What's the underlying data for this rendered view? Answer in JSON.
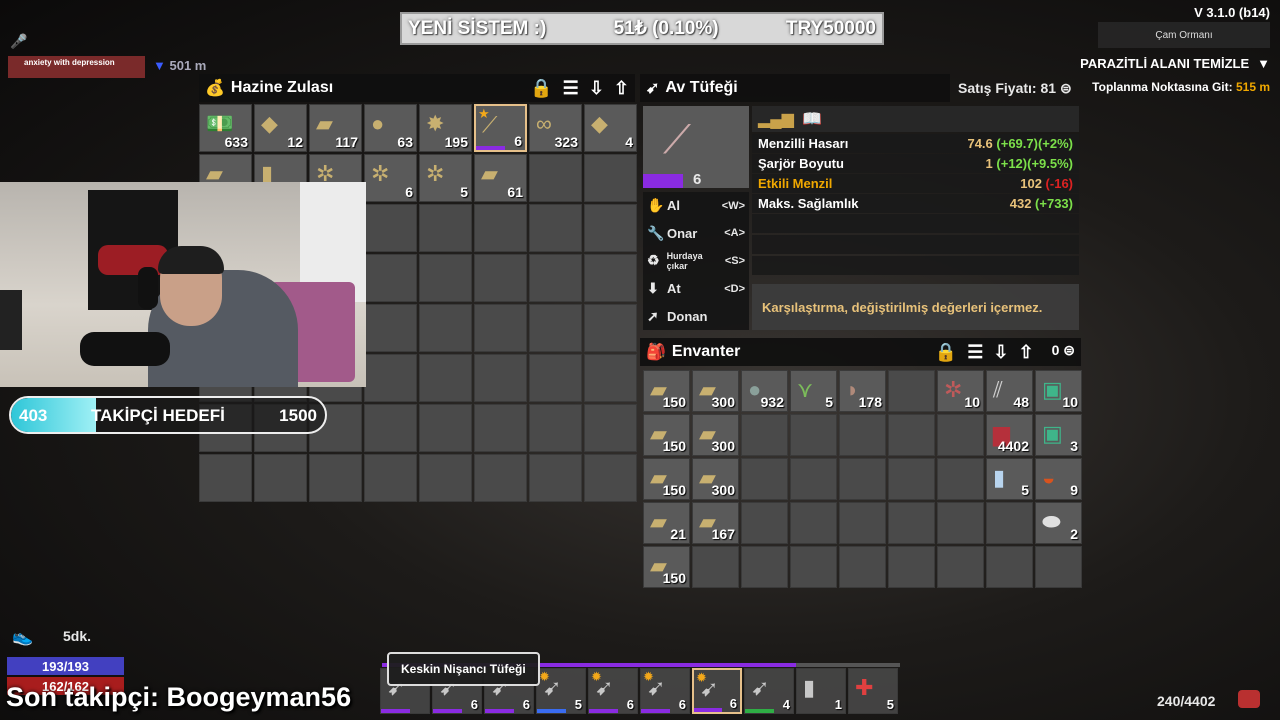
{
  "donation": {
    "label": "YENİ SİSTEM :)",
    "amount": "51₺ (0.10%)",
    "goal": "TRY50000"
  },
  "version": "V 3.1.0 (b14)",
  "biome": "Çam Ormanı",
  "quest": {
    "title": "PARAZİTLİ ALANI TEMİZLE",
    "objective": "Toplanma Noktasına Git: ",
    "distance": "515 m"
  },
  "party": {
    "member": "anxiety with depression",
    "distance": "501 m"
  },
  "chest": {
    "title": "Hazine Zulası",
    "items": [
      {
        "icon": "cash-icon",
        "glyph": "💵",
        "qty": "633"
      },
      {
        "icon": "silver-nuggets-icon",
        "glyph": "◆",
        "qty": "12"
      },
      {
        "icon": "ammo-round-icon",
        "glyph": "▰",
        "qty": "117"
      },
      {
        "icon": "grenade-icon",
        "glyph": "●",
        "qty": "63"
      },
      {
        "icon": "shotgun-shell-icon",
        "glyph": "✸",
        "qty": "195"
      },
      {
        "icon": "hunting-rifle-icon",
        "glyph": "⟋",
        "qty": "6",
        "star": true,
        "tier": true,
        "selected": true
      },
      {
        "icon": "chain-icon",
        "glyph": "∞",
        "qty": "323"
      },
      {
        "icon": "gold-nuggets-icon",
        "glyph": "◆",
        "qty": "4"
      },
      {
        "icon": "bullet-icon",
        "glyph": "▰",
        "qty": ""
      },
      {
        "icon": "casing-icon",
        "glyph": "▮",
        "qty": ""
      },
      {
        "icon": "parts-icon",
        "glyph": "✲",
        "qty": ""
      },
      {
        "icon": "rifle-parts-icon",
        "glyph": "✲",
        "qty": "6"
      },
      {
        "icon": "pistol-parts-icon",
        "glyph": "✲",
        "qty": "5"
      },
      {
        "icon": "bullet-tip-icon",
        "glyph": "▰",
        "qty": "61"
      }
    ],
    "total_slots": 64
  },
  "preview": {
    "title": "Av Tüfeği",
    "sell_label": "Satış Fiyatı: ",
    "sell_value": "81",
    "qty": "6",
    "actions": [
      {
        "icon": "hand-icon",
        "glyph": "✋",
        "label": "Al",
        "key": "<W>",
        "small": false
      },
      {
        "icon": "wrench-icon",
        "glyph": "🔧",
        "label": "Onar",
        "key": "<A>",
        "small": false
      },
      {
        "icon": "recycle-icon",
        "glyph": "♻",
        "label": "Hurdaya çıkar",
        "key": "<S>",
        "small": true
      },
      {
        "icon": "drop-arrow-icon",
        "glyph": "⬇",
        "label": "At",
        "key": "<D>",
        "small": false
      },
      {
        "icon": "equip-icon",
        "glyph": "➚",
        "label": "Donan",
        "key": "",
        "small": false
      }
    ],
    "stats": [
      {
        "label": "Menzilli Hasarı",
        "base": "74.6",
        "delta": "(+69.7)",
        "pct": "(+2%)",
        "label_color": "#ffffff",
        "delta_class": "pos"
      },
      {
        "label": "Şarjör Boyutu",
        "base": "1",
        "delta": "(+12)",
        "pct": "(+9.5%)",
        "label_color": "#ffffff",
        "delta_class": "pos"
      },
      {
        "label": "Etkili Menzil",
        "base": "102",
        "delta": "(-16)",
        "pct": "",
        "label_color": "#f0a800",
        "delta_class": "neg"
      },
      {
        "label": "Maks. Sağlamlık",
        "base": "432",
        "delta": "(+733)",
        "pct": "",
        "label_color": "#ffffff",
        "delta_class": "pos"
      }
    ],
    "compare_note": "Karşılaştırma, değiştirilmiş değerleri içermez."
  },
  "inventory": {
    "title": "Envanter",
    "coins": "0",
    "rows": [
      [
        {
          "icon": "rifle-ammo-icon",
          "qty": "150"
        },
        {
          "icon": "rifle-ammo-icon",
          "qty": "300"
        },
        {
          "icon": "stone-icon",
          "qty": "932"
        },
        {
          "icon": "plant-fiber-icon",
          "qty": "5"
        },
        {
          "icon": "meat-icon",
          "qty": "178"
        },
        {
          "icon": "",
          "qty": ""
        },
        {
          "icon": "gun-parts-icon",
          "qty": "10"
        },
        {
          "icon": "nails-icon",
          "qty": "48"
        },
        {
          "icon": "acid-jar-icon",
          "qty": "10"
        }
      ],
      [
        {
          "icon": "rifle-ammo-icon",
          "qty": "150"
        },
        {
          "icon": "rifle-ammo-icon",
          "qty": "300"
        },
        {
          "icon": "",
          "qty": ""
        },
        {
          "icon": "",
          "qty": ""
        },
        {
          "icon": "",
          "qty": ""
        },
        {
          "icon": "",
          "qty": ""
        },
        {
          "icon": "",
          "qty": ""
        },
        {
          "icon": "gas-can-icon",
          "qty": "4402"
        },
        {
          "icon": "acid-jar-icon",
          "qty": "3"
        }
      ],
      [
        {
          "icon": "rifle-ammo-icon",
          "qty": "150"
        },
        {
          "icon": "rifle-ammo-icon",
          "qty": "300"
        },
        {
          "icon": "",
          "qty": ""
        },
        {
          "icon": "",
          "qty": ""
        },
        {
          "icon": "",
          "qty": ""
        },
        {
          "icon": "",
          "qty": ""
        },
        {
          "icon": "",
          "qty": ""
        },
        {
          "icon": "water-bottle-icon",
          "qty": "5"
        },
        {
          "icon": "chili-bowl-icon",
          "qty": "9"
        }
      ],
      [
        {
          "icon": "rifle-ammo-icon",
          "qty": "21"
        },
        {
          "icon": "rifle-ammo-icon",
          "qty": "167"
        },
        {
          "icon": "",
          "qty": ""
        },
        {
          "icon": "",
          "qty": ""
        },
        {
          "icon": "",
          "qty": ""
        },
        {
          "icon": "",
          "qty": ""
        },
        {
          "icon": "",
          "qty": ""
        },
        {
          "icon": "",
          "qty": ""
        },
        {
          "icon": "bandage-icon",
          "qty": "2"
        }
      ],
      [
        {
          "icon": "rifle-ammo-icon",
          "qty": "150"
        },
        {
          "icon": "",
          "qty": ""
        },
        {
          "icon": "",
          "qty": ""
        },
        {
          "icon": "",
          "qty": ""
        },
        {
          "icon": "",
          "qty": ""
        },
        {
          "icon": "",
          "qty": ""
        },
        {
          "icon": "",
          "qty": ""
        },
        {
          "icon": "",
          "qty": ""
        },
        {
          "icon": "",
          "qty": ""
        }
      ]
    ]
  },
  "follower_goal": {
    "current": "403",
    "label": "TAKİPÇİ HEDEFİ",
    "target": "1500",
    "fraction": 0.27
  },
  "player": {
    "run_time": "5dk.",
    "stamina": "193/193",
    "health": "162/162"
  },
  "last_follower": "Son takipçi: Boogeyman56",
  "toolbelt": {
    "tooltip": "Keskin Nişancı Tüfeği",
    "slots": [
      {
        "icon": "sniper-rifle-icon",
        "qty": "",
        "star": false
      },
      {
        "icon": "pistol-icon",
        "qty": "6",
        "star": false
      },
      {
        "icon": "shotgun-icon",
        "qty": "6",
        "star": false
      },
      {
        "icon": "assault-rifle-icon",
        "qty": "5",
        "star": true
      },
      {
        "icon": "smg-icon",
        "qty": "6",
        "star": true
      },
      {
        "icon": "auger-icon",
        "qty": "6",
        "star": true
      },
      {
        "icon": "chainsaw-icon",
        "qty": "6",
        "star": true
      },
      {
        "icon": "nailgun-icon",
        "qty": "4",
        "star": false
      },
      {
        "icon": "beer-icon",
        "qty": "1",
        "star": false
      },
      {
        "icon": "first-aid-icon",
        "qty": "5",
        "star": false
      }
    ]
  },
  "bag": {
    "count": "240/4402"
  },
  "colors": {
    "tier_purple": "#8a2be2",
    "positive": "#7ce04a",
    "negative": "#dd2222",
    "warn": "#f0a800"
  }
}
